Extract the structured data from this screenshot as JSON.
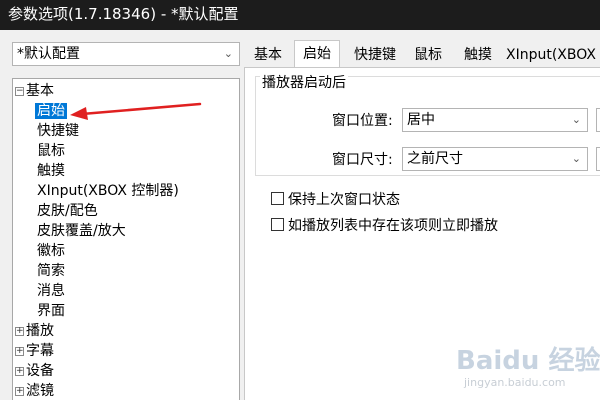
{
  "window": {
    "title": "参数选项(1.7.18346) - *默认配置"
  },
  "preset": {
    "value": "*默认配置"
  },
  "tree": {
    "nodes": [
      {
        "label": "基本",
        "expander": "⊟"
      },
      {
        "label": "启始"
      },
      {
        "label": "快捷键"
      },
      {
        "label": "鼠标"
      },
      {
        "label": "触摸"
      },
      {
        "label": "XInput(XBOX 控制器)"
      },
      {
        "label": "皮肤/配色"
      },
      {
        "label": "皮肤覆盖/放大"
      },
      {
        "label": "徽标"
      },
      {
        "label": "简索"
      },
      {
        "label": "消息"
      },
      {
        "label": "界面"
      },
      {
        "label": "播放",
        "expander": "⊞"
      },
      {
        "label": "字幕",
        "expander": "⊞"
      },
      {
        "label": "设备",
        "expander": "⊞"
      },
      {
        "label": "滤镜",
        "expander": "⊞"
      }
    ]
  },
  "tabs": [
    "基本",
    "启始",
    "快捷键",
    "鼠标",
    "触摸",
    "XInput(XBOX 控"
  ],
  "startup": {
    "group_title": "播放器启动后",
    "window_position_label": "窗口位置:",
    "window_position_value": "居中",
    "window_size_label": "窗口尺寸:",
    "window_size_value": "之前尺寸"
  },
  "options": {
    "keep_window_state": "保持上次窗口状态",
    "play_if_in_playlist": "如播放列表中存在该项则立即播放"
  },
  "watermark": {
    "main": "Baidu 经验",
    "sub": "jingyan.baidu.com"
  },
  "colors": {
    "titlebar": "#1c1c1c",
    "selection": "#0078d7",
    "annotation_arrow": "#e02020"
  }
}
